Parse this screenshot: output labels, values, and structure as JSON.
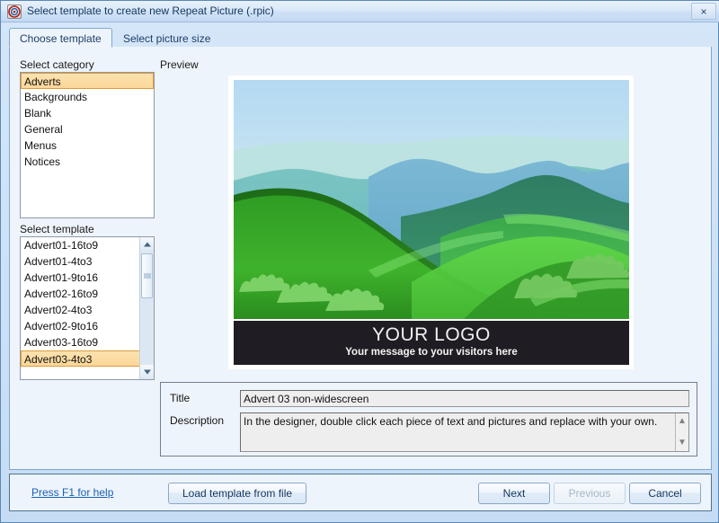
{
  "window": {
    "title": "Select template to create new Repeat Picture (.rpic)",
    "icon": "target-icon",
    "close_label": "×"
  },
  "tabs": [
    {
      "label": "Choose template",
      "active": true
    },
    {
      "label": "Select picture size",
      "active": false
    }
  ],
  "labels": {
    "select_category": "Select category",
    "select_template": "Select template",
    "preview": "Preview"
  },
  "categories": {
    "items": [
      {
        "label": "Adverts",
        "selected": true
      },
      {
        "label": "Backgrounds",
        "selected": false
      },
      {
        "label": "Blank",
        "selected": false
      },
      {
        "label": "General",
        "selected": false
      },
      {
        "label": "Menus",
        "selected": false
      },
      {
        "label": "Notices",
        "selected": false
      }
    ]
  },
  "templates": {
    "items": [
      {
        "label": "Advert01-16to9",
        "selected": false
      },
      {
        "label": "Advert01-4to3",
        "selected": false
      },
      {
        "label": "Advert01-9to16",
        "selected": false
      },
      {
        "label": "Advert02-16to9",
        "selected": false
      },
      {
        "label": "Advert02-4to3",
        "selected": false
      },
      {
        "label": "Advert02-9to16",
        "selected": false
      },
      {
        "label": "Advert03-16to9",
        "selected": false
      },
      {
        "label": "Advert03-4to3",
        "selected": true
      }
    ]
  },
  "preview": {
    "logo_text": "YOUR LOGO",
    "message_text": "Your message to your visitors here",
    "banner_color": "#201c23",
    "sky_top_color": "#b8dcf3",
    "sky_bottom_color": "#cdeee3",
    "hill_green_color": "#39a526",
    "mountain_blue_color": "#69afcd"
  },
  "details": {
    "title_label": "Title",
    "title_value": "Advert 03 non-widescreen",
    "description_label": "Description",
    "description_value": "In the designer, double click each piece of text and pictures and replace with your own."
  },
  "footer": {
    "help_link": "Press F1 for help",
    "load_button": "Load template from file",
    "next_button": "Next",
    "previous_button": "Previous",
    "cancel_button": "Cancel",
    "previous_disabled": true
  }
}
